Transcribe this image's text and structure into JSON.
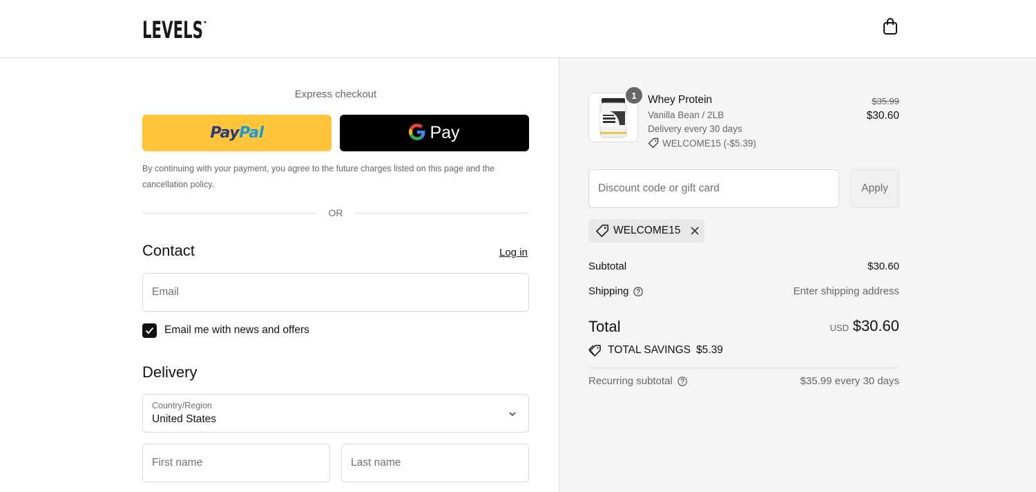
{
  "header": {
    "logo_text": "LEVELS",
    "bag_icon": "shopping-bag-icon"
  },
  "express": {
    "title": "Express checkout",
    "paypal_label_a": "Pay",
    "paypal_label_b": "Pal",
    "gpay_label": "Pay",
    "consent": "By continuing with your payment, you agree to the future charges listed on this page and the cancellation policy.",
    "or": "OR"
  },
  "contact": {
    "heading": "Contact",
    "login": "Log in",
    "email_placeholder": "Email",
    "newsletter_label": "Email me with news and offers",
    "newsletter_checked": true
  },
  "delivery": {
    "heading": "Delivery",
    "country_label": "Country/Region",
    "country_value": "United States",
    "first_name_placeholder": "First name",
    "last_name_placeholder": "Last name"
  },
  "cart": {
    "quantity": "1",
    "product_name": "Whey Protein",
    "variant": "Vanilla Bean / 2LB",
    "delivery_note": "Delivery every 30 days",
    "discount_note": "WELCOME15 (-$5.39)",
    "original_price": "$35.99",
    "price": "$30.60"
  },
  "discount": {
    "placeholder": "Discount code or gift card",
    "apply": "Apply",
    "applied_code": "WELCOME15"
  },
  "summary": {
    "subtotal_label": "Subtotal",
    "subtotal_value": "$30.60",
    "shipping_label": "Shipping",
    "shipping_value": "Enter shipping address",
    "total_label": "Total",
    "currency": "USD",
    "total_value": "$30.60",
    "savings_label": "TOTAL SAVINGS",
    "savings_value": "$5.39",
    "recurring_label": "Recurring subtotal",
    "recurring_value": "$35.99 every 30 days"
  },
  "colors": {
    "paypal_yellow": "#ffc439",
    "paypal_dark_blue": "#253b80",
    "paypal_light_blue": "#179bd7",
    "gpay_black": "#000000",
    "summary_bg": "#f5f5f5"
  }
}
